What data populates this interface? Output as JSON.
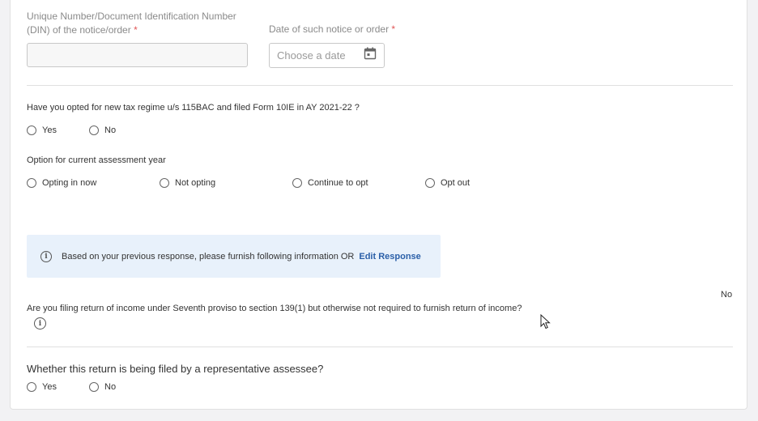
{
  "notice": {
    "din_label": "Unique Number/Document Identification Number (DIN) of the notice/order",
    "din_label_line1": "Unique Number/Document Identification Number",
    "din_label_line2": "(DIN) of the notice/order",
    "required_mark": "*",
    "din_value": "",
    "date_label": "Date of such notice or order",
    "date_placeholder": "Choose a date"
  },
  "tax_regime": {
    "question": "Have you opted for new tax regime u/s 115BAC and filed Form 10IE in AY 2021-22 ?",
    "options": [
      "Yes",
      "No"
    ]
  },
  "current_year": {
    "question": "Option for current assessment year",
    "options": [
      "Opting in now",
      "Not opting",
      "Continue to opt",
      "Opt out"
    ]
  },
  "info_banner": {
    "text": "Based on your previous response, please furnish following information OR",
    "link": "Edit Response"
  },
  "seventh_proviso": {
    "question": "Are you filing return of income under Seventh proviso to section 139(1) but otherwise not required to furnish return of income?",
    "answer": "No"
  },
  "representative": {
    "question": "Whether this return is being filed by a representative assessee?",
    "options": [
      "Yes",
      "No"
    ]
  },
  "icons": {
    "calendar": "calendar-icon",
    "info": "info-icon",
    "cursor": "mouse-pointer-icon"
  },
  "colors": {
    "link": "#2a5fa8",
    "info_bg": "#e8f1fb",
    "required": "#e05555"
  }
}
